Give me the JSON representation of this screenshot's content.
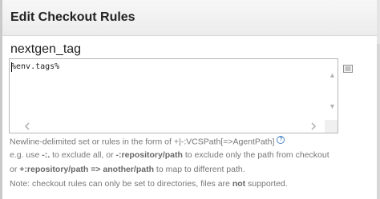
{
  "dialog": {
    "title": "Edit Checkout Rules"
  },
  "field": {
    "name": "nextgen_tag",
    "value": "%env.tags%"
  },
  "hints": {
    "line1": "Newline-delimited set or rules in the form of +|-:VCSPath[=>AgentPath]",
    "line2": {
      "p1": "e.g. use ",
      "b1": "-:.",
      "p2": " to exclude all, or ",
      "b2": "-:repository/path",
      "p3": " to exclude only the path from checkout"
    },
    "line3": {
      "p1": "or ",
      "b1": "+:repository/path => another/path",
      "p2": " to map to different path."
    },
    "line4": {
      "p1": "Note: checkout rules can only be set to directories, files are ",
      "b1": "not",
      "p2": " supported."
    }
  },
  "icons": {
    "help": "help-circle-icon",
    "expand": "expand-editor-icon",
    "scroll_up": "scroll-up-arrow-icon",
    "scroll_down": "scroll-down-arrow-icon",
    "scroll_left": "scroll-left-arrow-icon",
    "scroll_right": "scroll-right-arrow-icon"
  },
  "colors": {
    "header_bg": "#efefef",
    "hint_text": "#777777",
    "help_blue": "#4a86c5"
  }
}
